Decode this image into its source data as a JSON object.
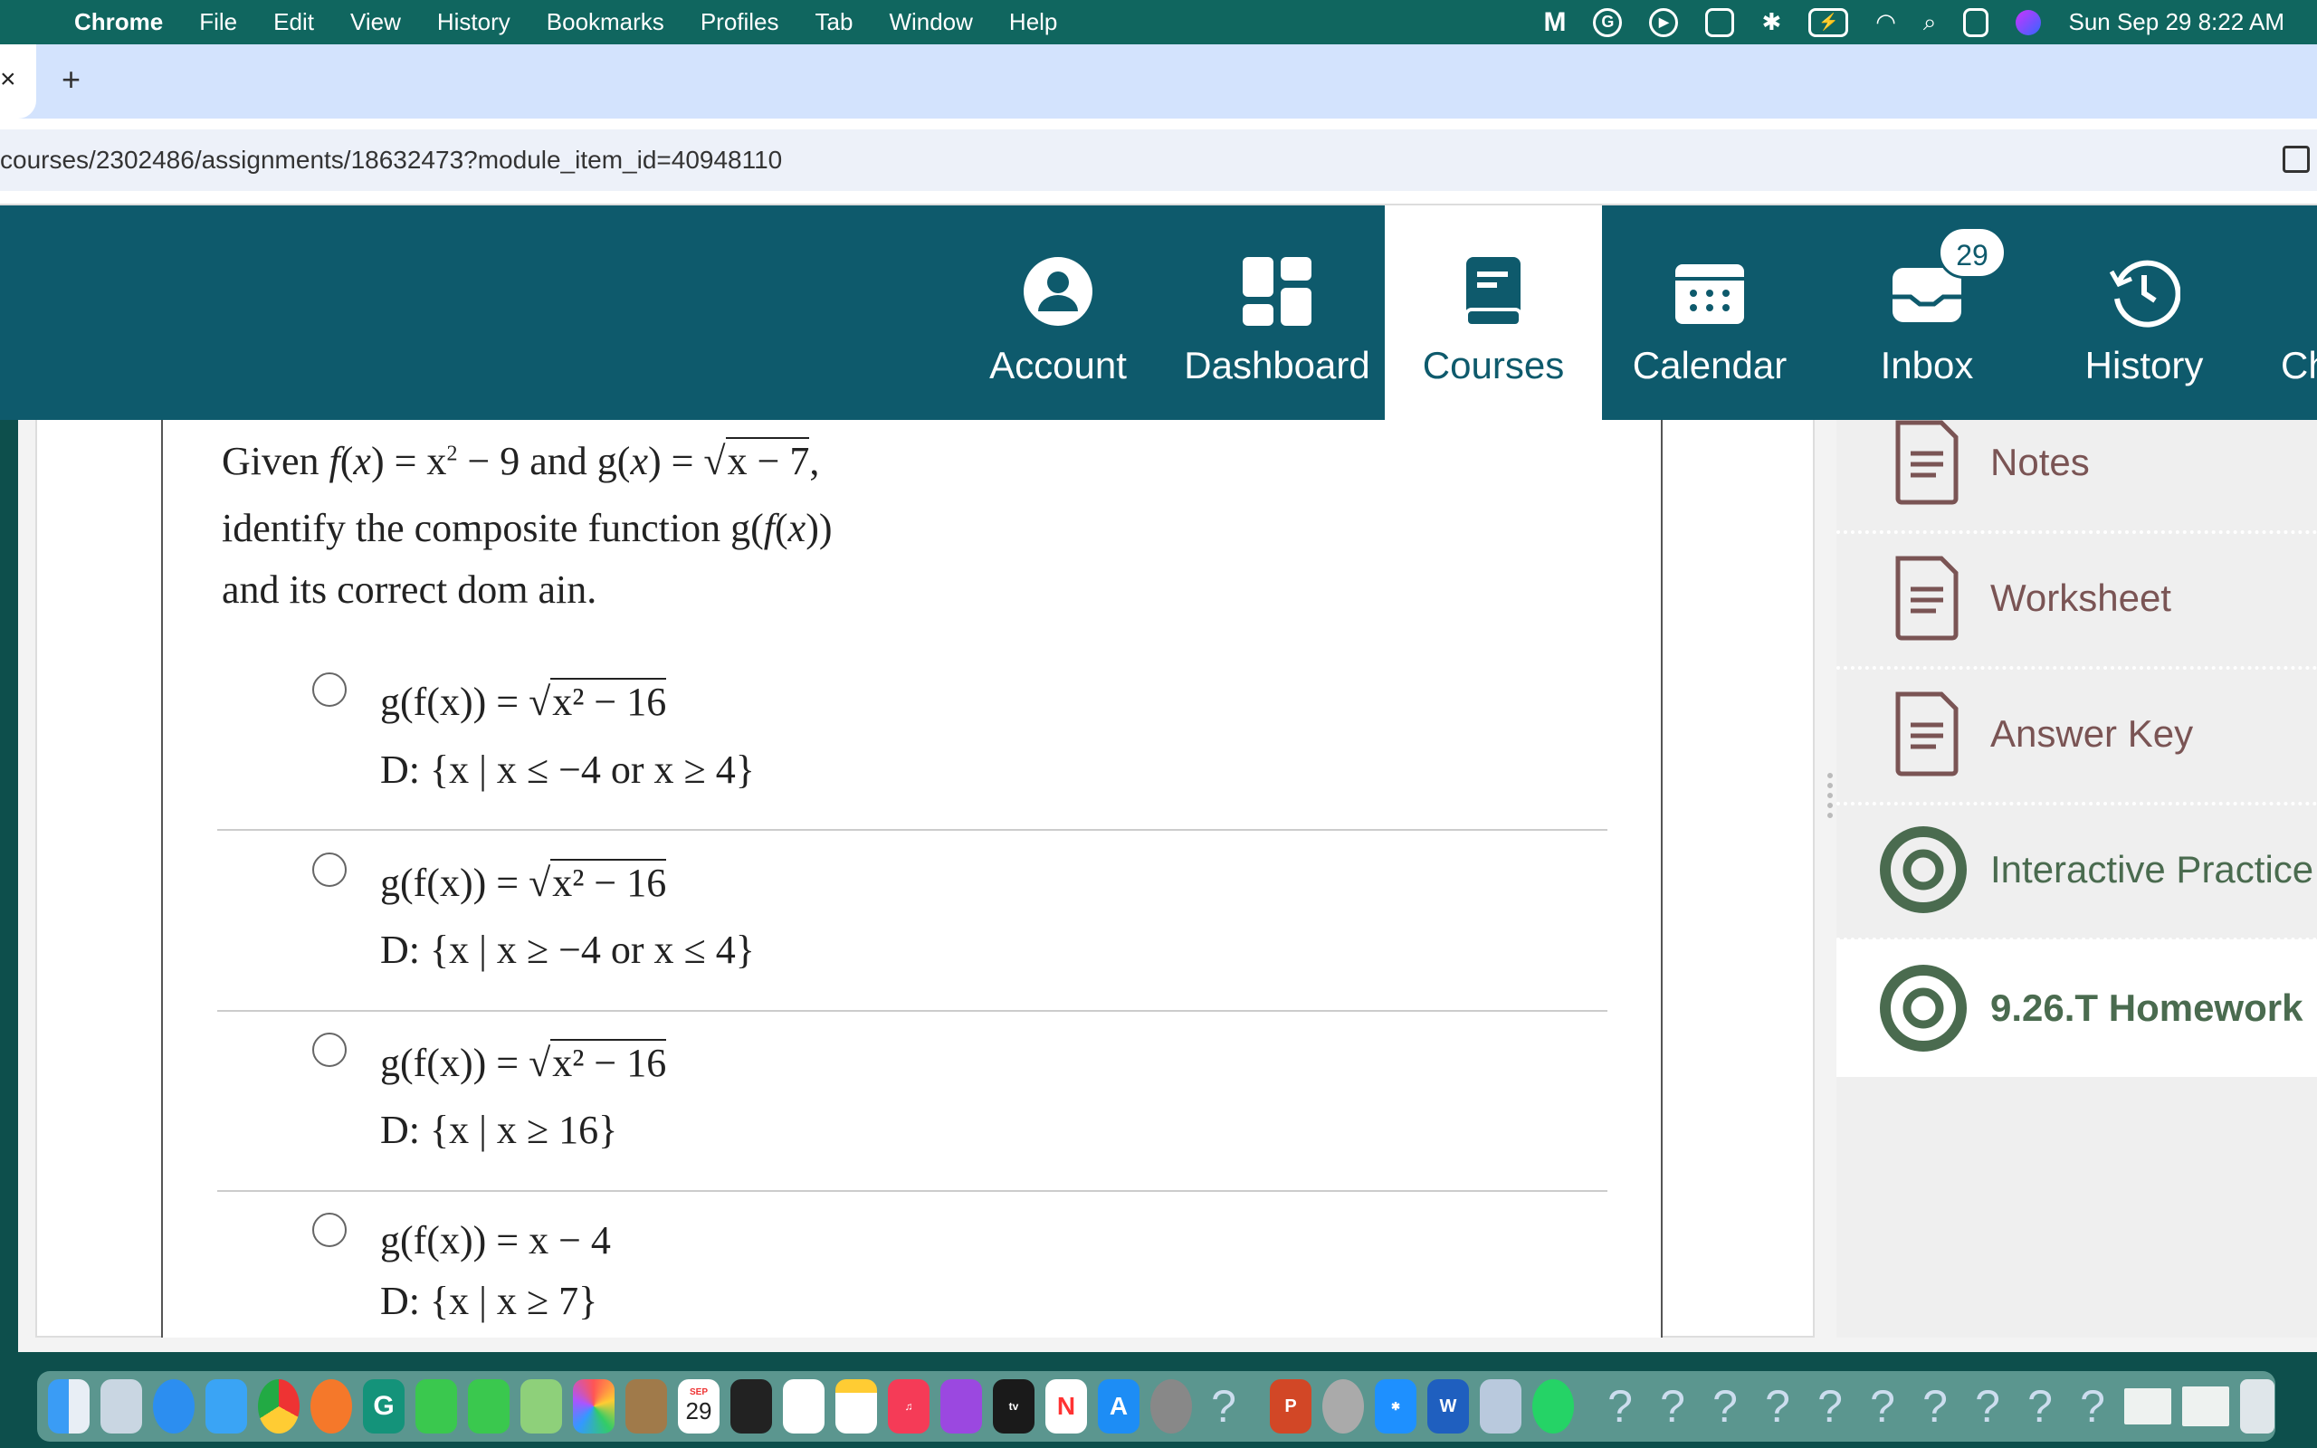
{
  "menubar": {
    "app": "Chrome",
    "items": [
      "File",
      "Edit",
      "View",
      "History",
      "Bookmarks",
      "Profiles",
      "Tab",
      "Window",
      "Help"
    ],
    "datetime": "Sun Sep 29  8:22 AM"
  },
  "tabs": {
    "close": "×",
    "new_tab": "+"
  },
  "address": {
    "url": "courses/2302486/assignments/18632473?module_item_id=40948110"
  },
  "nav": {
    "items": [
      {
        "label": "Account",
        "icon": "account-icon"
      },
      {
        "label": "Dashboard",
        "icon": "dashboard-icon"
      },
      {
        "label": "Courses",
        "icon": "courses-icon",
        "active": true
      },
      {
        "label": "Calendar",
        "icon": "calendar-icon"
      },
      {
        "label": "Inbox",
        "icon": "inbox-icon",
        "badge": "29"
      },
      {
        "label": "History",
        "icon": "history-icon"
      },
      {
        "label": "Ch"
      }
    ]
  },
  "question": {
    "line1_pre": "Given ",
    "f": "f",
    "x": "x",
    "line1_mid": " = x",
    "sq": "2",
    "line1_mid2": " − 9 and g",
    "line1_root": "x − 7",
    "line2": "identify the composite function g",
    "line3": "and its correct dom ain.",
    "options": [
      {
        "lhs": "g(f(x)) = ",
        "root": "x² − 16",
        "domain": "D: {x | x ≤ −4 or x ≥ 4}"
      },
      {
        "lhs": "g(f(x)) = ",
        "root": "x² − 16",
        "domain": "D: {x | x ≥ −4 or x ≤ 4}"
      },
      {
        "lhs": "g(f(x)) = ",
        "root": "x² − 16",
        "domain": "D: {x | x ≥ 16}"
      },
      {
        "lhs": "g(f(x)) = x − 4",
        "root": "",
        "domain": "D: {x | x ≥ 7}"
      }
    ]
  },
  "sidebar": {
    "items": [
      {
        "label": "Notes",
        "type": "page"
      },
      {
        "label": "Worksheet",
        "type": "page"
      },
      {
        "label": "Answer Key",
        "type": "page"
      },
      {
        "label": "Interactive Practice",
        "type": "assignment"
      },
      {
        "label": "9.26.T Homework",
        "type": "assignment",
        "current": true
      }
    ],
    "colors": {
      "page": "#7a5454",
      "assignment": "#4a6b4f"
    }
  },
  "dock": {
    "calendar_month": "SEP",
    "calendar_day": "29",
    "unknown": "?"
  },
  "colors": {
    "menubar": "#10665f",
    "nav": "#0e5a6c",
    "tabbar": "#d3e3fd"
  }
}
